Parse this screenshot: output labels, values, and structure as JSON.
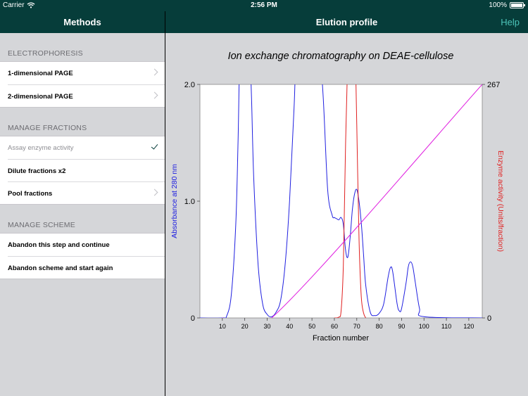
{
  "status_bar": {
    "carrier": "Carrier",
    "time": "2:56 PM",
    "battery": "100%"
  },
  "left_nav": {
    "title": "Methods"
  },
  "right_nav": {
    "title": "Elution profile",
    "help_label": "Help"
  },
  "sidebar": {
    "sections": [
      {
        "header": "ELECTROPHORESIS",
        "items": [
          {
            "label": "1-dimensional PAGE",
            "accessory": "chevron",
            "enabled": true
          },
          {
            "label": "2-dimensional PAGE",
            "accessory": "chevron",
            "enabled": true
          }
        ]
      },
      {
        "header": "MANAGE FRACTIONS",
        "items": [
          {
            "label": "Assay enzyme activity",
            "accessory": "checkmark",
            "enabled": false
          },
          {
            "label": "Dilute fractions x2",
            "accessory": "none",
            "enabled": true
          },
          {
            "label": "Pool fractions",
            "accessory": "chevron",
            "enabled": true
          }
        ]
      },
      {
        "header": "MANAGE SCHEME",
        "items": [
          {
            "label": "Abandon this step and continue",
            "accessory": "none",
            "enabled": true
          },
          {
            "label": "Abandon scheme and start again",
            "accessory": "none",
            "enabled": true
          }
        ]
      }
    ]
  },
  "colors": {
    "nav_background": "#063d3a",
    "help_accent": "#4cc3b8",
    "absorbance": "#2020e0",
    "enzyme": "#e02020",
    "gradient": "#e020e0"
  },
  "chart_data": {
    "type": "line",
    "title": "Ion exchange chromatography on DEAE-cellulose",
    "xlabel": "Fraction number",
    "ylabel_left": "Absorbance at 280 nm",
    "ylabel_right": "Enzyme activity (Units/fraction)",
    "xlim": [
      0,
      126
    ],
    "xticks": [
      10,
      20,
      30,
      40,
      50,
      60,
      70,
      80,
      90,
      100,
      110,
      120
    ],
    "ylim_left": [
      0,
      2.0
    ],
    "yticks_left": [
      {
        "value": 0,
        "label": "0"
      },
      {
        "value": 1.0,
        "label": "1.0"
      },
      {
        "value": 2.0,
        "label": "2.0"
      }
    ],
    "ylim_right": [
      0,
      267
    ],
    "yticks_right": [
      {
        "value": 0,
        "label": "0"
      },
      {
        "value": 267,
        "label": "267"
      }
    ],
    "grid": false,
    "series": [
      {
        "key": "absorbance",
        "axis": "left",
        "x": [
          0,
          10,
          12,
          14,
          16,
          17,
          18,
          20,
          22,
          23,
          24,
          26,
          28,
          30,
          32,
          34,
          36,
          38,
          40,
          42,
          44,
          50,
          53,
          55,
          57,
          59,
          60,
          61,
          62,
          63,
          64,
          65,
          66,
          67,
          68,
          69,
          70,
          71,
          72,
          73,
          74,
          76,
          78,
          80,
          82,
          84,
          85,
          86,
          88,
          89,
          90,
          92,
          93,
          94,
          95,
          96,
          98,
          100,
          126
        ],
        "y": [
          0,
          0,
          0.02,
          0.2,
          0.8,
          1.5,
          2.4,
          2.8,
          2.4,
          1.9,
          1.2,
          0.45,
          0.12,
          0.03,
          0.01,
          0.05,
          0.15,
          0.45,
          1.0,
          1.8,
          2.6,
          2.8,
          2.4,
          1.9,
          1.1,
          0.88,
          0.86,
          0.85,
          0.84,
          0.86,
          0.8,
          0.58,
          0.52,
          0.68,
          0.92,
          1.06,
          1.1,
          1.0,
          0.82,
          0.55,
          0.28,
          0.05,
          0.02,
          0.04,
          0.12,
          0.35,
          0.43,
          0.4,
          0.12,
          0.06,
          0.08,
          0.3,
          0.44,
          0.48,
          0.44,
          0.32,
          0.08,
          0.01,
          0
        ]
      },
      {
        "key": "enzyme",
        "axis": "right",
        "x": [
          60,
          62,
          63,
          64,
          65,
          66,
          67,
          68,
          69,
          70,
          71,
          72,
          73,
          74
        ],
        "y": [
          0,
          1,
          8,
          60,
          200,
          300,
          350,
          360,
          340,
          220,
          90,
          25,
          6,
          0
        ]
      },
      {
        "key": "gradient",
        "axis": "left",
        "x": [
          10,
          32,
          126
        ],
        "y": [
          0,
          0,
          2.0
        ]
      }
    ]
  }
}
